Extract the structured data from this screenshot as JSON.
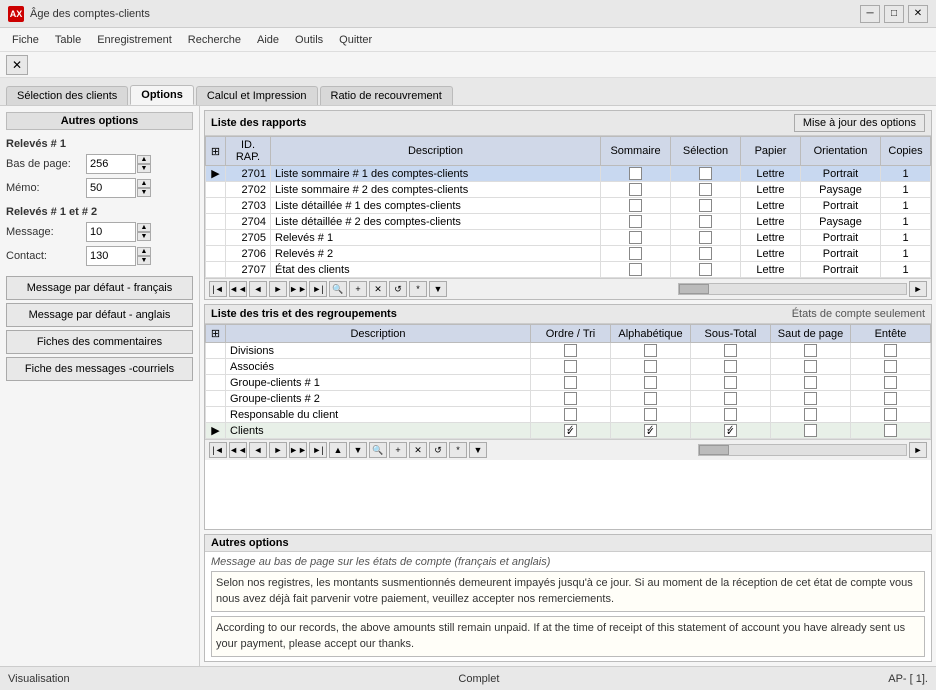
{
  "titleBar": {
    "icon": "AX",
    "title": "Âge des comptes-clients",
    "minBtn": "─",
    "maxBtn": "□",
    "closeBtn": "✕"
  },
  "menuBar": {
    "items": [
      "Fiche",
      "Table",
      "Enregistrement",
      "Recherche",
      "Aide",
      "Outils",
      "Quitter"
    ]
  },
  "tabs": [
    {
      "label": "Sélection des clients",
      "active": false
    },
    {
      "label": "Options",
      "active": true
    },
    {
      "label": "Calcul et Impression",
      "active": false
    },
    {
      "label": "Ratio de recouvrement",
      "active": false
    }
  ],
  "leftPanel": {
    "title": "Autres options",
    "section1": {
      "label": "Relevés # 1",
      "fields": [
        {
          "label": "Bas de page:",
          "value": "256"
        },
        {
          "label": "Mémo:",
          "value": "50"
        }
      ]
    },
    "section2": {
      "label": "Relevés # 1 et # 2",
      "fields": [
        {
          "label": "Message:",
          "value": "10"
        },
        {
          "label": "Contact:",
          "value": "130"
        }
      ]
    },
    "buttons": [
      "Message par défaut - français",
      "Message par défaut - anglais",
      "Fiches des commentaires",
      "Fiche des messages -courriels"
    ]
  },
  "reportsSection": {
    "title": "Liste des rapports",
    "updateBtn": "Mise à jour des options",
    "columns": [
      "ID. RAP.",
      "Description",
      "Sommaire",
      "Sélection",
      "Papier",
      "Orientation",
      "Copies"
    ],
    "rows": [
      {
        "id": "2701",
        "desc": "Liste sommaire # 1 des comptes-clients",
        "sommaire": false,
        "selection": false,
        "papier": "Lettre",
        "orientation": "Portrait",
        "copies": "1",
        "arrow": true
      },
      {
        "id": "2702",
        "desc": "Liste sommaire # 2 des comptes-clients",
        "sommaire": false,
        "selection": false,
        "papier": "Lettre",
        "orientation": "Paysage",
        "copies": "1"
      },
      {
        "id": "2703",
        "desc": "Liste détaillée # 1 des comptes-clients",
        "sommaire": false,
        "selection": false,
        "papier": "Lettre",
        "orientation": "Portrait",
        "copies": "1"
      },
      {
        "id": "2704",
        "desc": "Liste détaillée # 2 des comptes-clients",
        "sommaire": false,
        "selection": false,
        "papier": "Lettre",
        "orientation": "Paysage",
        "copies": "1"
      },
      {
        "id": "2705",
        "desc": "Relevés # 1",
        "sommaire": false,
        "selection": false,
        "papier": "Lettre",
        "orientation": "Portrait",
        "copies": "1"
      },
      {
        "id": "2706",
        "desc": "Relevés # 2",
        "sommaire": false,
        "selection": false,
        "papier": "Lettre",
        "orientation": "Portrait",
        "copies": "1"
      },
      {
        "id": "2707",
        "desc": "État des clients",
        "sommaire": false,
        "selection": false,
        "papier": "Lettre",
        "orientation": "Portrait",
        "copies": "1"
      }
    ]
  },
  "sortsSection": {
    "title": "Liste des tris et des regroupements",
    "subtitle": "États de compte seulement",
    "columns": [
      "Description",
      "Ordre / Tri",
      "Alphabétique",
      "Sous-Total",
      "Saut de page",
      "Entête"
    ],
    "rows": [
      {
        "desc": "Divisions",
        "ordre": false,
        "alpha": false,
        "sous": false,
        "saut": false,
        "entete": false
      },
      {
        "desc": "Associés",
        "ordre": false,
        "alpha": false,
        "sous": false,
        "saut": false,
        "entete": false
      },
      {
        "desc": "Groupe-clients # 1",
        "ordre": false,
        "alpha": false,
        "sous": false,
        "saut": false,
        "entete": false
      },
      {
        "desc": "Groupe-clients # 2",
        "ordre": false,
        "alpha": false,
        "sous": false,
        "saut": false,
        "entete": false
      },
      {
        "desc": "Responsable du client",
        "ordre": false,
        "alpha": false,
        "sous": false,
        "saut": false,
        "entete": false
      },
      {
        "desc": "Clients",
        "ordre": true,
        "alpha": true,
        "sous": true,
        "saut": false,
        "entete": false,
        "arrow": true
      }
    ]
  },
  "optionsSection": {
    "title": "Autres options",
    "messageLabel": "Message au bas de page sur les états de compte (français et anglais)",
    "messageFR": "Selon nos registres, les montants susmentionnés demeurent impayés jusqu'à ce jour. Si au moment de la réception de cet état de compte vous nous avez déjà fait parvenir votre paiement, veuillez accepter nos remerciements.",
    "messageEN": "According to our records, the above amounts still remain unpaid. If at the time of receipt of this statement of account you have already sent us your payment, please accept our thanks."
  },
  "statusBar": {
    "left": "Visualisation",
    "middle": "Complet",
    "right": "AP- [ 1]."
  }
}
